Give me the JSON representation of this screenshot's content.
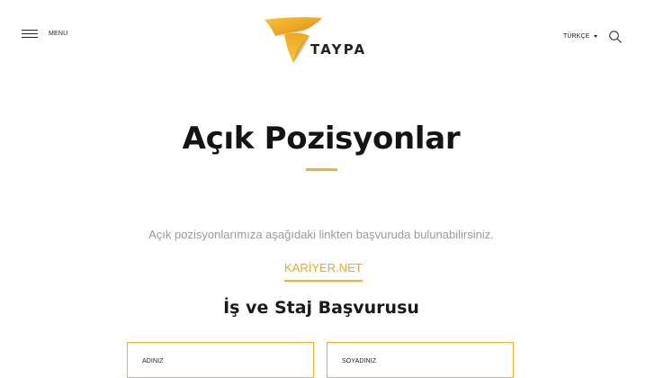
{
  "header": {
    "menu_label": "MENU",
    "logo_text": "TAYPA",
    "language_label": "TÜRKÇE",
    "brand_color": "#f0b323"
  },
  "main": {
    "title": "Açık Pozisyonlar",
    "intro_text": "Açık pozisyonlarımıza aşağıdaki linkten başvuruda bulunabilirsiniz.",
    "link_label": "KARİYER.NET",
    "form_title": "İş ve Staj Başvurusu"
  },
  "form": {
    "fields": [
      {
        "label": "ADINIZ",
        "value": ""
      },
      {
        "label": "SOYADINIZ",
        "value": ""
      }
    ]
  },
  "icons": {
    "menu": "hamburger-icon",
    "language_dropdown": "caret-down-icon",
    "search": "search-icon",
    "logo": "taypa-logo-icon"
  }
}
